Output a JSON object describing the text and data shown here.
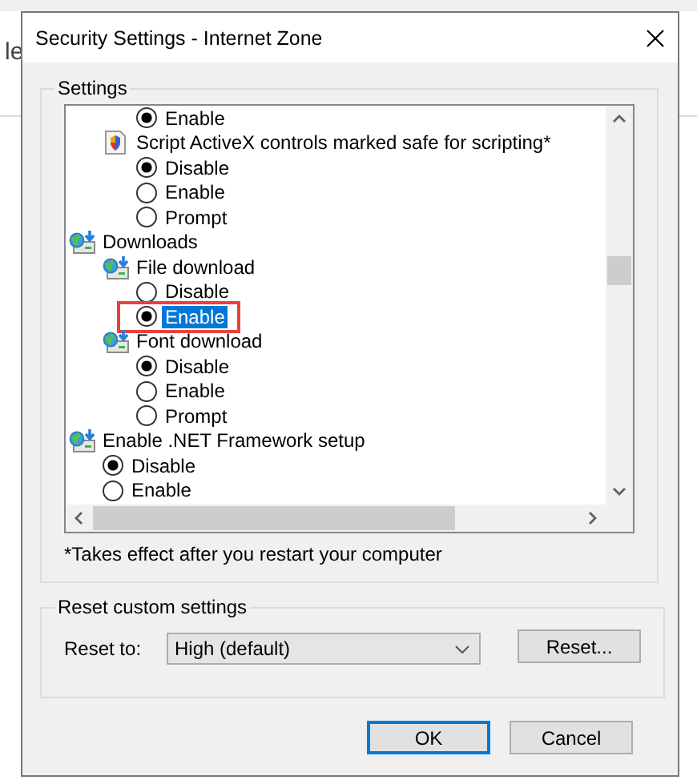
{
  "background": {
    "text": "le"
  },
  "window": {
    "title": "Security Settings - Internet Zone"
  },
  "settings": {
    "title": "Settings",
    "tree": [
      {
        "kind": "category",
        "children": [
          {
            "kind": "setting",
            "children": [
              {
                "kind": "option",
                "label": "Enable",
                "selected": true,
                "focused": false,
                "annotated": false
              }
            ]
          },
          {
            "kind": "setting",
            "label": "Script ActiveX controls marked safe for scripting*",
            "children": [
              {
                "kind": "option",
                "label": "Disable",
                "selected": true,
                "focused": false,
                "annotated": false
              },
              {
                "kind": "option",
                "label": "Enable",
                "selected": false,
                "focused": false,
                "annotated": false
              },
              {
                "kind": "option",
                "label": "Prompt",
                "selected": false,
                "focused": false,
                "annotated": false
              }
            ]
          }
        ]
      },
      {
        "kind": "category",
        "label": "Downloads",
        "children": [
          {
            "kind": "category",
            "label": "File download",
            "children": [
              {
                "kind": "option",
                "label": "Disable",
                "selected": false,
                "focused": false,
                "annotated": false
              },
              {
                "kind": "option",
                "label": "Enable",
                "selected": true,
                "focused": true,
                "annotated": true
              }
            ]
          },
          {
            "kind": "category",
            "label": "Font download",
            "children": [
              {
                "kind": "option",
                "label": "Disable",
                "selected": true,
                "focused": false,
                "annotated": false
              },
              {
                "kind": "option",
                "label": "Enable",
                "selected": false,
                "focused": false,
                "annotated": false
              },
              {
                "kind": "option",
                "label": "Prompt",
                "selected": false,
                "focused": false,
                "annotated": false
              }
            ]
          }
        ]
      },
      {
        "kind": "category",
        "label": "Enable .NET Framework setup",
        "children": [
          {
            "kind": "option",
            "label": "Disable",
            "selected": true,
            "focused": false,
            "annotated": false
          },
          {
            "kind": "option",
            "label": "Enable",
            "selected": false,
            "focused": false,
            "annotated": false
          }
        ]
      }
    ],
    "note": "*Takes effect after you restart your computer"
  },
  "reset": {
    "title": "Reset custom settings",
    "label": "Reset to:",
    "value": "High (default)",
    "button": "Reset..."
  },
  "buttons": [
    {
      "label": "OK",
      "default": true
    },
    {
      "label": "Cancel",
      "default": false
    }
  ]
}
